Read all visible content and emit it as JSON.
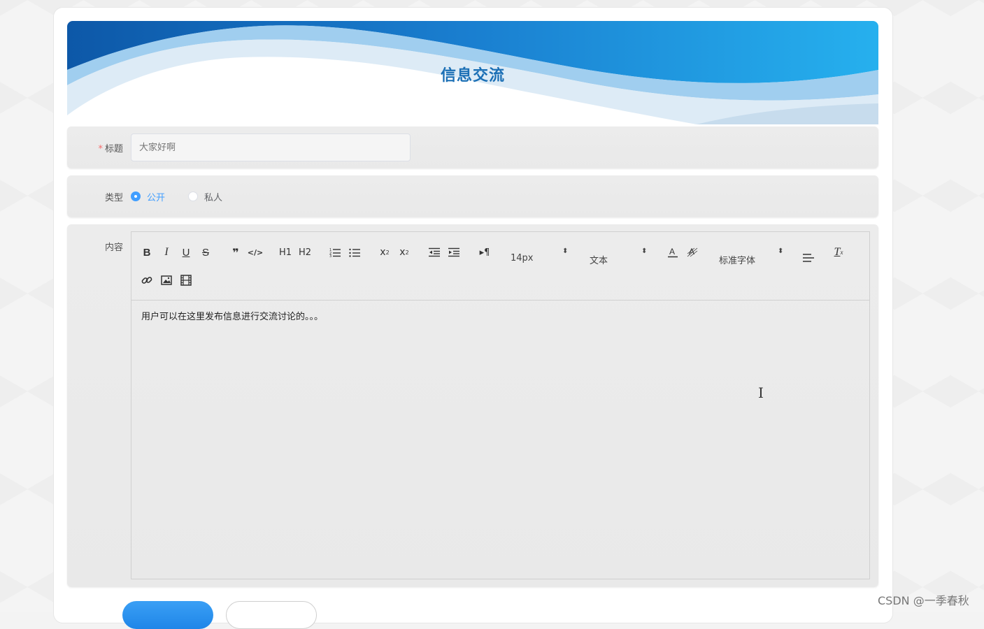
{
  "banner": {
    "title": "信息交流"
  },
  "form": {
    "title_field": {
      "required_mark": "*",
      "label": "标题",
      "placeholder": "大家好啊"
    },
    "type_field": {
      "label": "类型",
      "options": [
        {
          "label": "公开",
          "selected": true
        },
        {
          "label": "私人",
          "selected": false
        }
      ]
    },
    "content_field": {
      "label": "内容",
      "editor_text": "用户可以在这里发布信息进行交流讨论的。。。",
      "toolbar": {
        "h1": "H1",
        "h2": "H2",
        "size_picker": "14px",
        "header_picker": "文本",
        "font_picker": "标准字体"
      }
    }
  },
  "watermark": "CSDN @一季春秋",
  "colors": {
    "accent": "#409eff",
    "title_blue": "#1b6fb5",
    "required": "#f56c6c"
  }
}
